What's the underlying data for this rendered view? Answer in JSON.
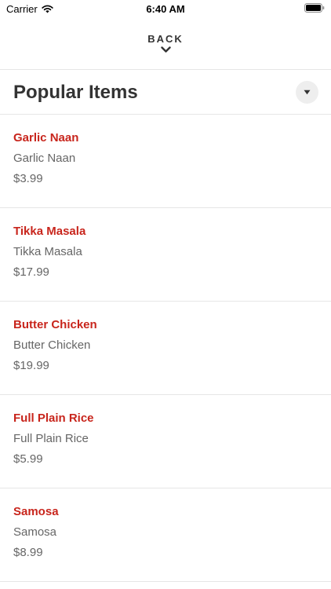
{
  "status_bar": {
    "carrier": "Carrier",
    "time": "6:40 AM",
    "wifi_icon": "wifi-icon",
    "battery_icon": "battery-icon"
  },
  "nav": {
    "back_label": "BACK",
    "back_icon": "chevron-down-icon"
  },
  "section": {
    "title": "Popular Items",
    "toggle_icon": "caret-down-icon"
  },
  "colors": {
    "item_name": "#c8251c",
    "text_secondary": "#666666",
    "divider": "#e6e6e6"
  },
  "items": [
    {
      "name": "Garlic Naan",
      "description": "Garlic Naan",
      "price": "$3.99"
    },
    {
      "name": "Tikka Masala",
      "description": "Tikka Masala",
      "price": "$17.99"
    },
    {
      "name": "Butter Chicken",
      "description": "Butter Chicken",
      "price": "$19.99"
    },
    {
      "name": "Full Plain Rice",
      "description": "Full Plain Rice",
      "price": "$5.99"
    },
    {
      "name": "Samosa",
      "description": "Samosa",
      "price": "$8.99"
    }
  ]
}
